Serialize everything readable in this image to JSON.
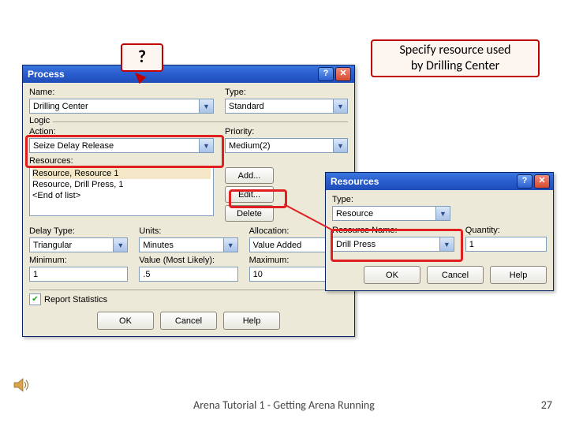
{
  "callouts": {
    "q": "?",
    "spec_l1": "Specify resource used",
    "spec_l2": "by Drilling Center"
  },
  "process": {
    "title": "Process",
    "name_label": "Name:",
    "name_value": "Drilling Center",
    "type_label": "Type:",
    "type_value": "Standard",
    "logic_label": "Logic",
    "action_label": "Action:",
    "action_value": "Seize Delay Release",
    "priority_label": "Priority:",
    "priority_value": "Medium(2)",
    "resources_label": "Resources:",
    "res_item1": "Resource, Resource 1",
    "res_item2": "Resource, Drill Press, 1",
    "res_item3": "<End of list>",
    "add": "Add...",
    "edit": "Edit...",
    "delete": "Delete",
    "delaytype_label": "Delay Type:",
    "delaytype_value": "Triangular",
    "units_label": "Units:",
    "units_value": "Minutes",
    "allocation_label": "Allocation:",
    "allocation_value": "Value Added",
    "min_label": "Minimum:",
    "min_value": "1",
    "most_label": "Value (Most Likely):",
    "most_value": ".5",
    "max_label": "Maximum:",
    "max_value": "10",
    "report": "Report Statistics",
    "ok": "OK",
    "cancel": "Cancel",
    "help": "Help"
  },
  "resources": {
    "title": "Resources",
    "type_label": "Type:",
    "type_value": "Resource",
    "name_label": "Resource Name:",
    "name_value": "Drill Press",
    "qty_label": "Quantity:",
    "qty_value": "1",
    "ok": "OK",
    "cancel": "Cancel",
    "help": "Help"
  },
  "footer": "Arena Tutorial 1 - Getting Arena Running",
  "slidenum": "27"
}
